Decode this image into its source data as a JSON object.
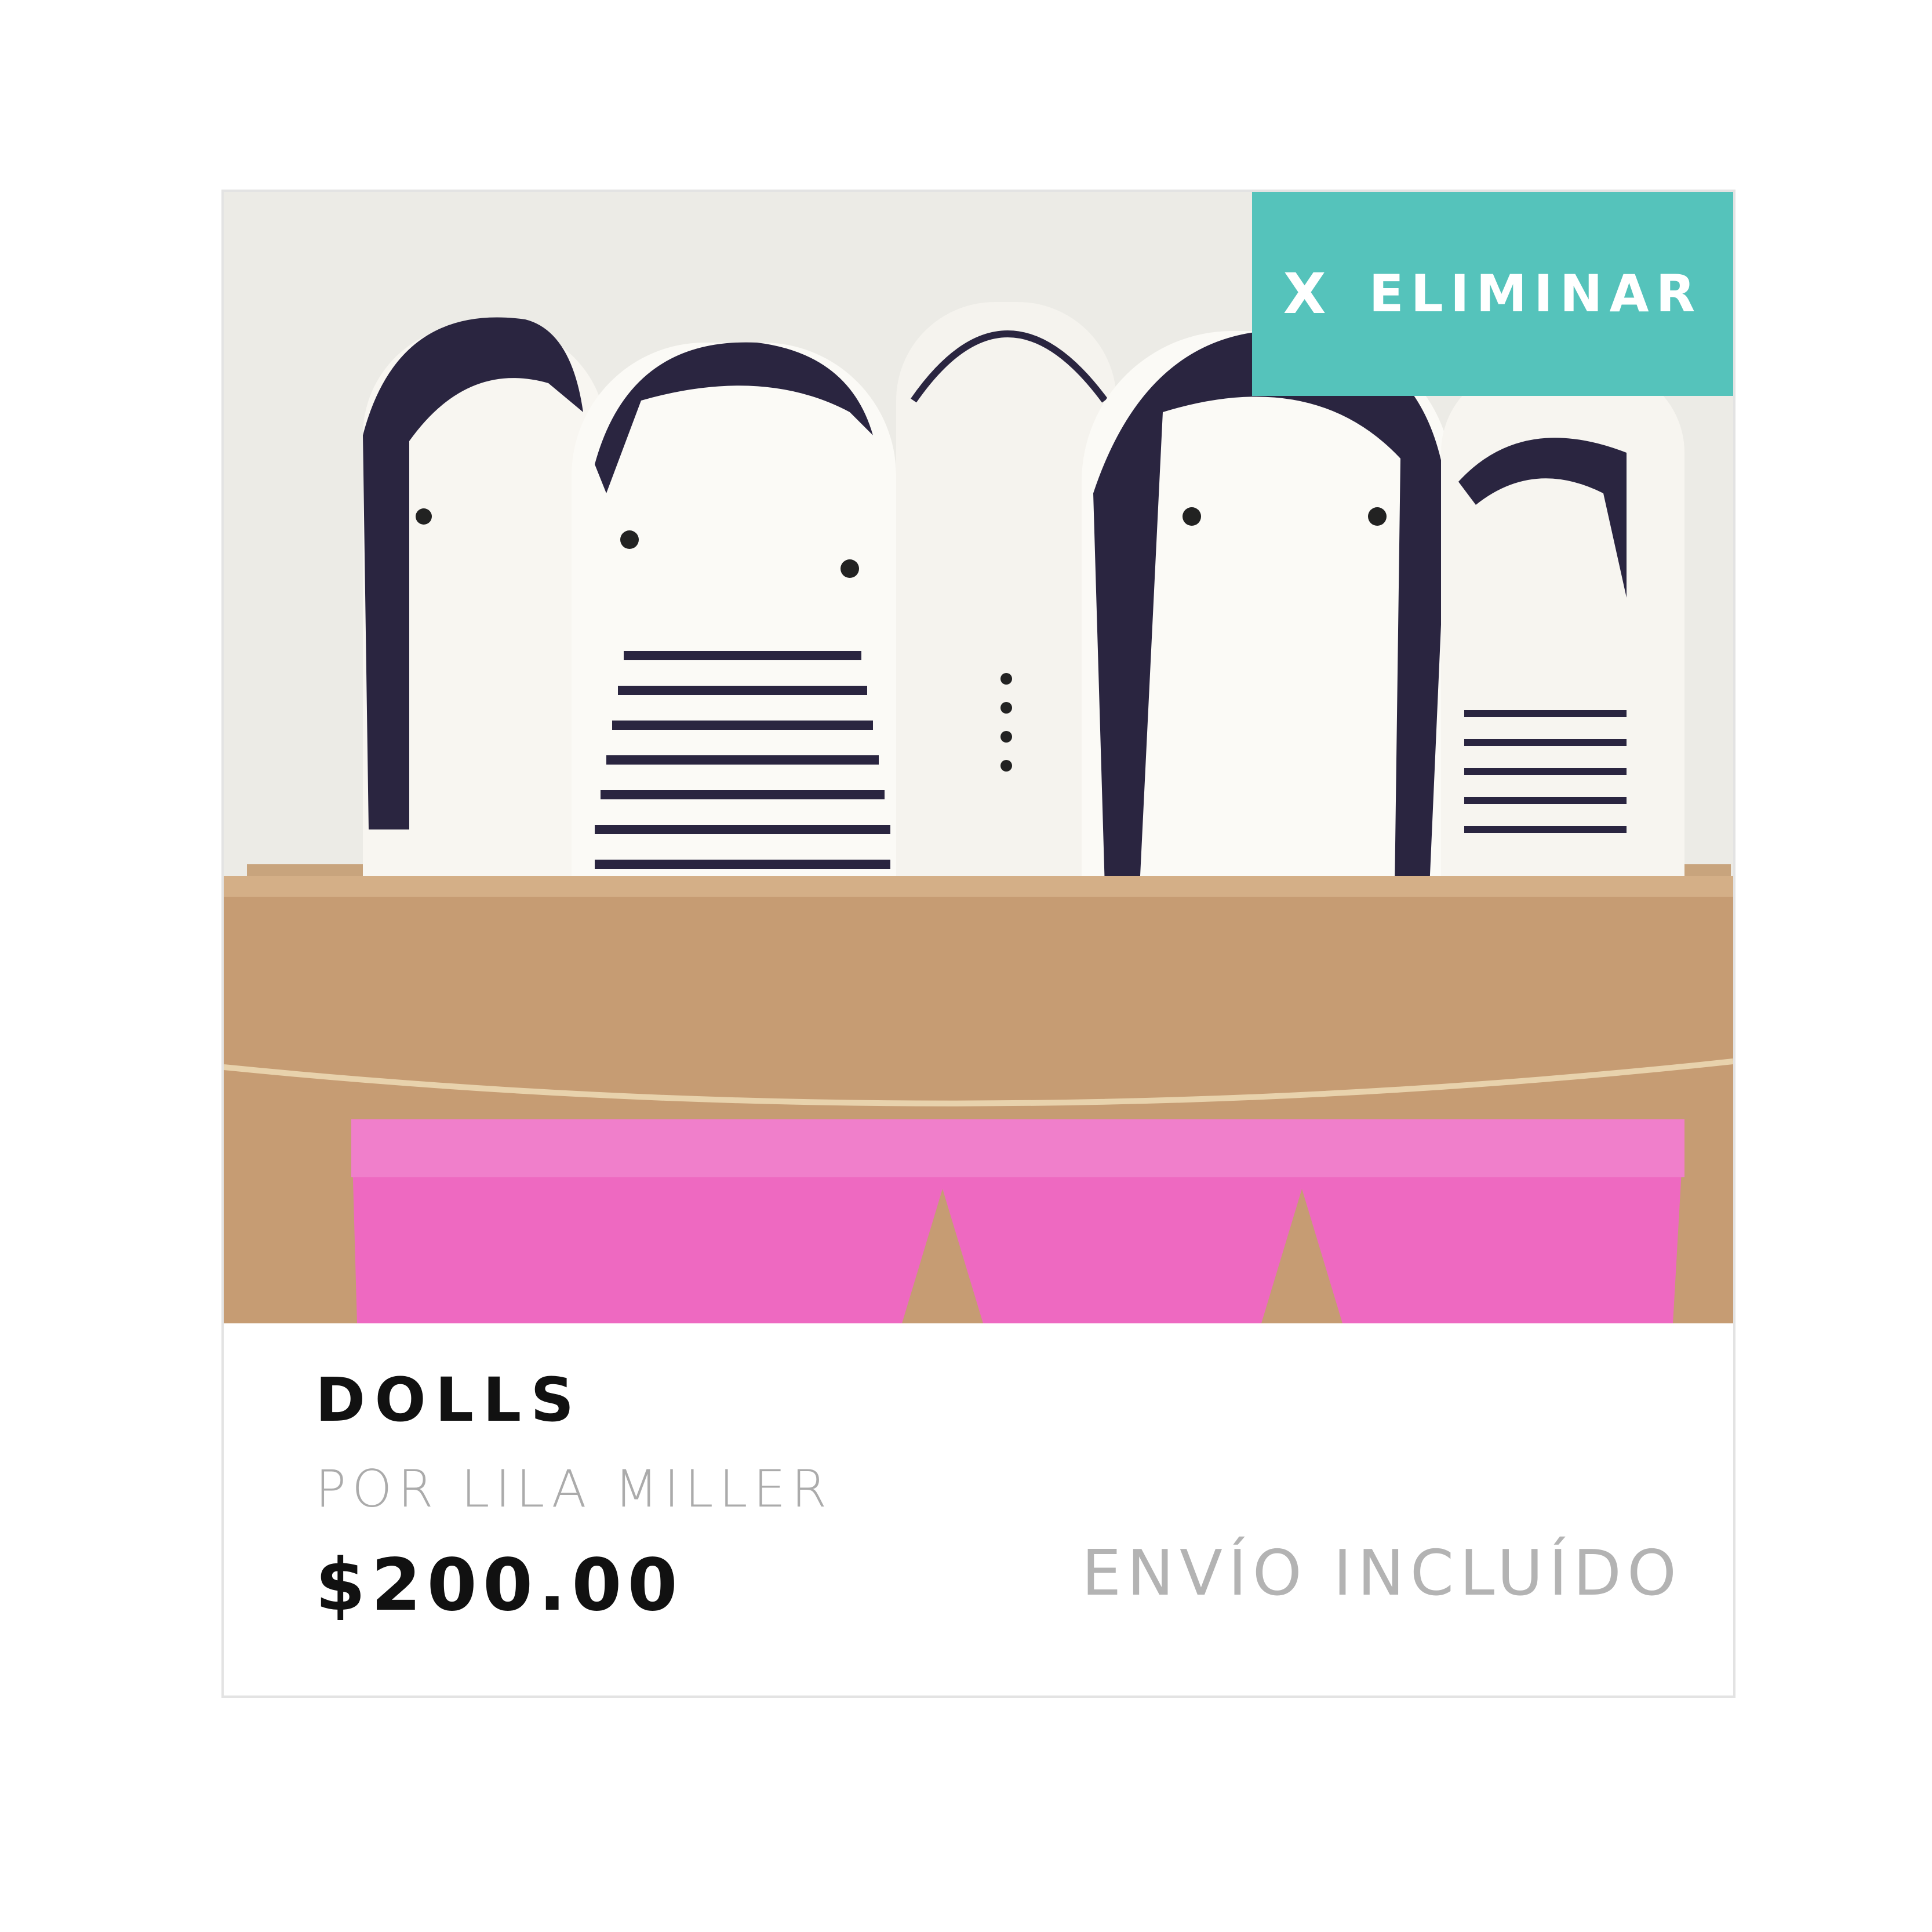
{
  "product": {
    "remove_icon": "X",
    "remove_label": "ELIMINAR",
    "title": "DOLLS",
    "author": "POR LILA MILLER",
    "price": "$200.00",
    "shipping": "ENVÍO INCLUÍDO",
    "image_description": "photo-of-fabric-dolls-in-cardboard-box-with-pink-bunting"
  },
  "colors": {
    "remove_button_bg": "#55c3bb",
    "card_border": "#e3e3e3",
    "title_text": "#111111",
    "muted_text": "#ababab"
  }
}
